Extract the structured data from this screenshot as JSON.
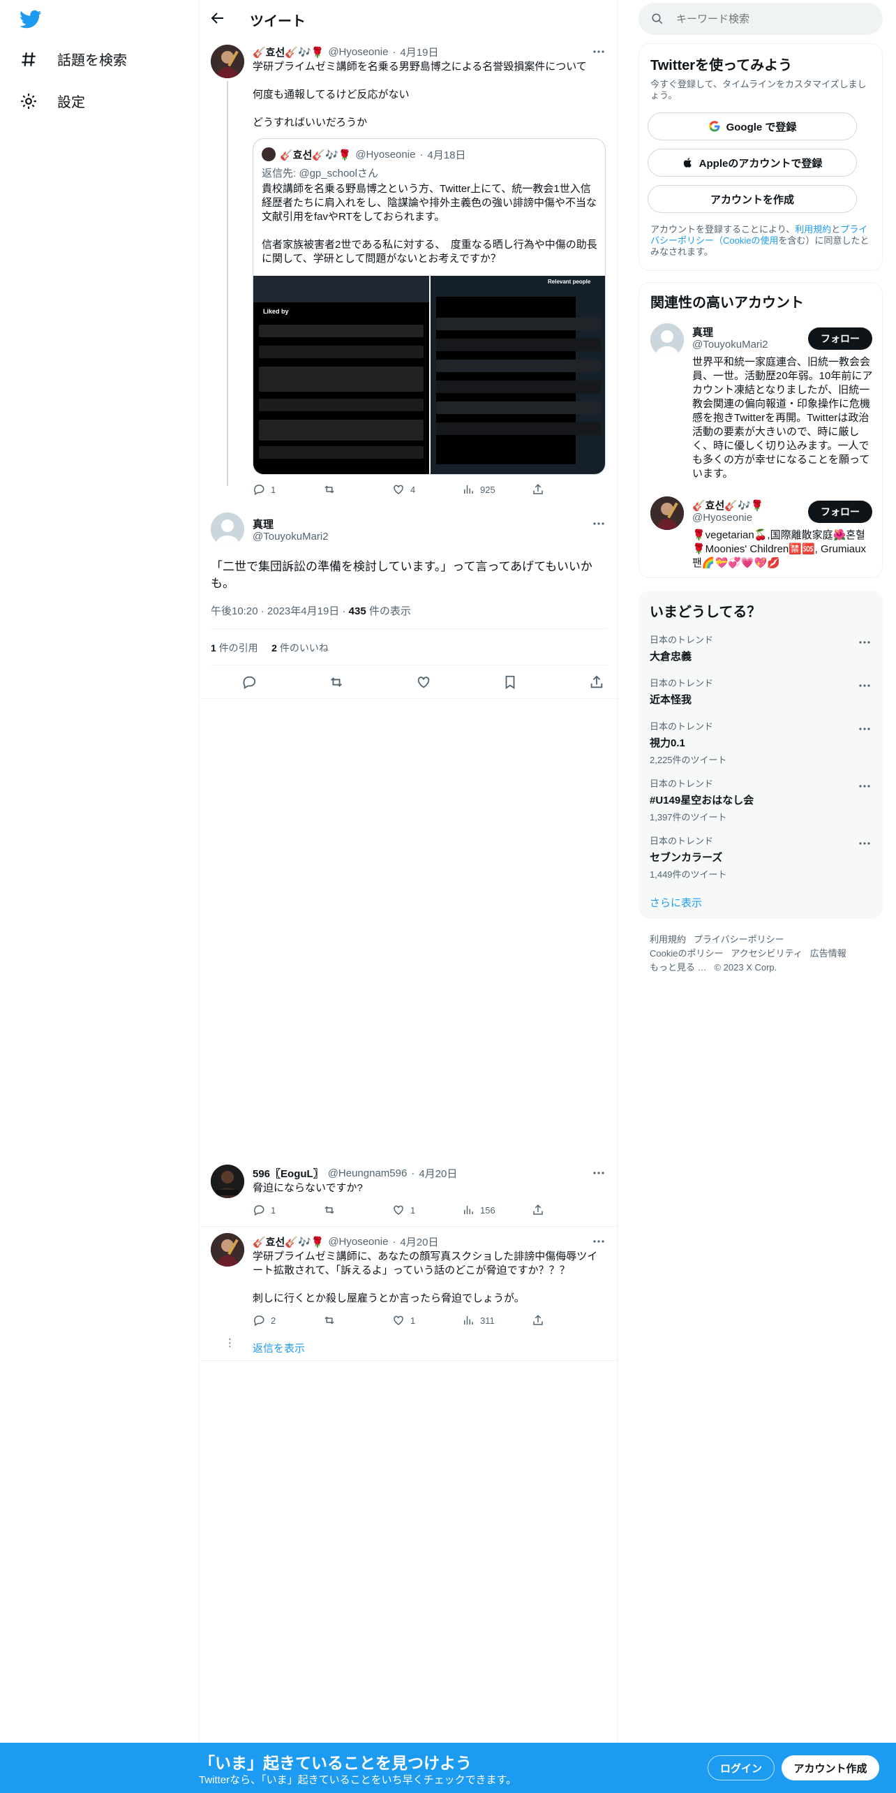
{
  "left_nav": {
    "explore_label": "話題を検索",
    "settings_label": "設定"
  },
  "header": {
    "title": "ツイート"
  },
  "parent_tweet": {
    "name": "🎸효선🎸🎶🌹",
    "handle": "@Hyoseonie",
    "date": "4月19日",
    "text": "学研プライムゼミ講師を名乗る男野島博之による名誉毀損案件について\n\n何度も通報してるけど反応がない\n\nどうすればいいだろうか",
    "quote": {
      "name": "🎸효선🎸🎶🌹",
      "handle": "@Hyoseonie",
      "date": "4月18日",
      "reply_to_prefix": "返信先: ",
      "reply_to_handle": "@gp_schoolさん",
      "text": "貴校講師を名乗る野島博之という方、Twitter上にて、統一教会1世入信経歴者たちに肩入れをし、陰謀論や排外主義色の強い誹謗中傷や不当な文献引用をfavやRTをしておられます。\n\n信者家族被害者2世である私に対する、　度重なる晒し行為や中傷の助長に関して、学研として問題がないとお考えですか？"
    },
    "stats": {
      "replies": "1",
      "retweets": "",
      "likes": "4",
      "views": "925"
    }
  },
  "main_tweet": {
    "name": "真理",
    "handle": "@TouyokuMari2",
    "text": "「二世で集団訴訟の準備を検討しています。」って言ってあげてもいいかも。",
    "time": "午後10:20",
    "date": "2023年4月19日",
    "views": "435",
    "views_label": "件の表示",
    "quotes": "1",
    "quotes_label": "件の引用",
    "likes": "2",
    "likes_label": "件のいいね"
  },
  "replies": [
    {
      "name": "596〖EoguL〗",
      "handle": "@Heungnam596",
      "date": "4月20日",
      "text": "脅迫にならないですか?",
      "replies": "1",
      "likes": "1",
      "views": "156"
    },
    {
      "name": "🎸효선🎸🎶🌹",
      "handle": "@Hyoseonie",
      "date": "4月20日",
      "text": "学研プライムゼミ講師に、あなたの顔写真スクショした誹謗中傷侮辱ツイート拡散されて、「訴えるよ」っていう話のどこが脅迫ですか？？？\n\n刺しに行くとか殺し屋雇うとか言ったら脅迫でしょうが。",
      "replies": "2",
      "likes": "1",
      "views": "311"
    }
  ],
  "show_replies": "返信を表示",
  "search": {
    "placeholder": "キーワード検索"
  },
  "signup": {
    "title": "Twitterを使ってみよう",
    "subtitle": "今すぐ登録して、タイムラインをカスタマイズしましょう。",
    "google": "Google で登録",
    "apple": "Appleのアカウントで登録",
    "create": "アカウントを作成",
    "legal_1": "アカウントを登録することにより、",
    "legal_terms": "利用規約",
    "legal_2": "と",
    "legal_privacy": "プライバシーポリシー（Cookieの使用",
    "legal_3": "を含む）に同意したとみなされます。"
  },
  "relevant": {
    "title": "関連性の高いアカウント",
    "follow": "フォロー",
    "accounts": [
      {
        "name": "真理",
        "handle": "@TouyokuMari2",
        "bio": "世界平和統一家庭連合、旧統一教会会員、一世。活動歴20年弱。10年前にアカウント凍結となりましたが、旧統一教会関連の偏向報道・印象操作に危機感を抱きTwitterを再開。Twitterは政治活動の要素が大きいので、時に厳しく、時に優しく切り込みます。一人でも多くの方が幸せになることを願っています。"
      },
      {
        "name": "🎸효선🎸🎶🌹",
        "handle": "@Hyoseonie",
        "bio": "🌹vegetarian🍒,国際離散家庭🌺혼혈🌹Moonies' Children🈲🆘, Grumiaux팬🌈💝💞💗💖💋"
      }
    ]
  },
  "trends": {
    "title": "いまどうしてる？",
    "items": [
      {
        "category": "日本のトレンド",
        "title": "大倉忠義",
        "count": ""
      },
      {
        "category": "日本のトレンド",
        "title": "近本怪我",
        "count": ""
      },
      {
        "category": "日本のトレンド",
        "title": "視力0.1",
        "count": "2,225件のツイート"
      },
      {
        "category": "日本のトレンド",
        "title": "#U149星空おはなし会",
        "count": "1,397件のツイート"
      },
      {
        "category": "日本のトレンド",
        "title": "セブンカラーズ",
        "count": "1,449件のツイート"
      }
    ],
    "show_more": "さらに表示"
  },
  "footer": {
    "terms": "利用規約",
    "privacy": "プライバシーポリシー",
    "cookie": "Cookieのポリシー",
    "accessibility": "アクセシビリティ",
    "ads": "広告情報",
    "more": "もっと見る …",
    "copyright": "© 2023 X Corp."
  },
  "bottom_bar": {
    "headline": "「いま」起きていることを見つけよう",
    "sub": "Twitterなら、「いま」起きていることをいち早くチェックできます。",
    "login": "ログイン",
    "signup": "アカウント作成"
  },
  "colors": {
    "accent": "#1d9bf0",
    "text": "#0f1419",
    "muted": "#536471",
    "border": "#eff3f4"
  },
  "icons": [
    "twitter-logo-icon",
    "hashtag-icon",
    "gear-icon",
    "back-arrow-icon",
    "search-icon",
    "reply-icon",
    "retweet-icon",
    "like-icon",
    "views-icon",
    "share-icon",
    "bookmark-icon",
    "more-icon",
    "google-icon",
    "apple-icon"
  ]
}
